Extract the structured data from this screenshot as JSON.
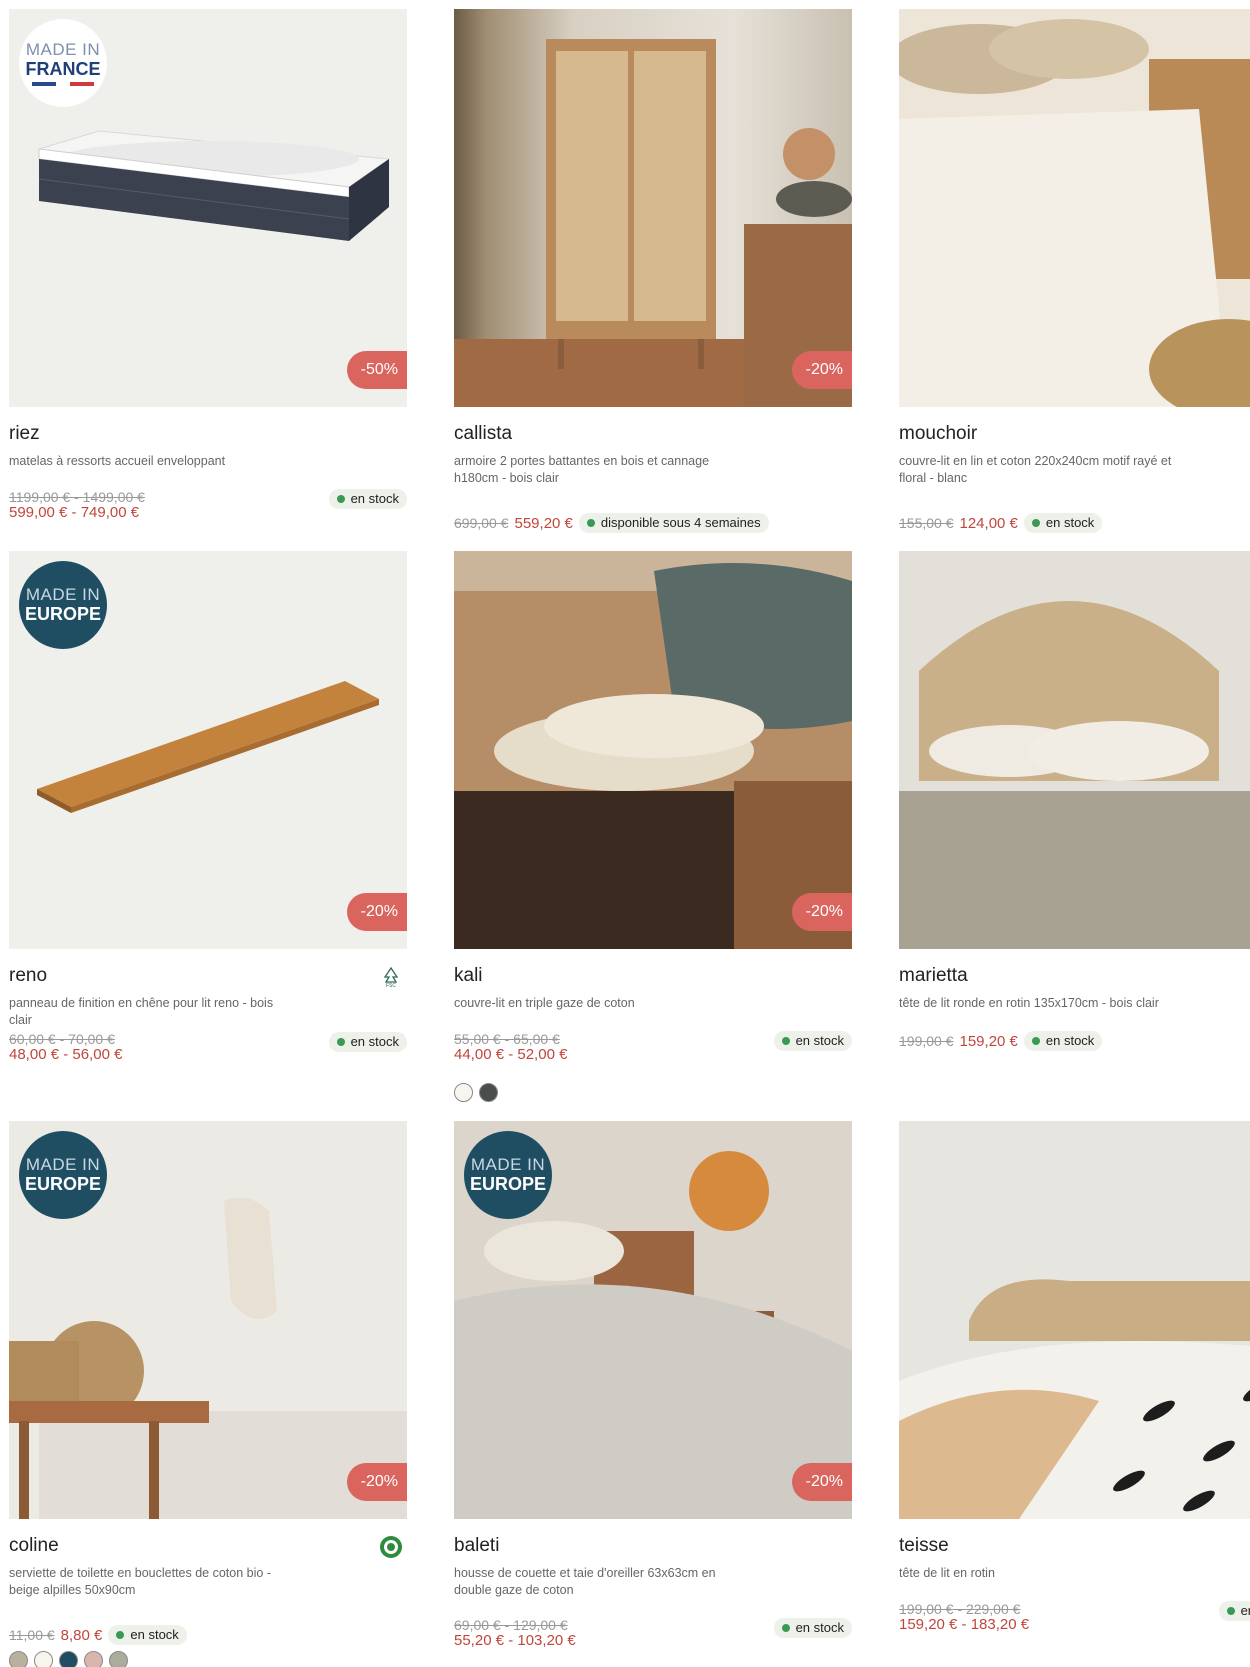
{
  "products": [
    {
      "name": "riez",
      "desc": "matelas à ressorts accueil enveloppant",
      "old": "1199,00 € - 1499,00 €",
      "new": "599,00 € - 749,00 €",
      "discount": "-50%",
      "stock": "en stock",
      "origin_l1": "MADE IN",
      "origin_l2": "FRANCE"
    },
    {
      "name": "callista",
      "desc": "armoire 2 portes battantes en bois et cannage h180cm - bois clair",
      "old": "699,00 €",
      "new": "559,20 €",
      "discount": "-20%",
      "stock": "disponible sous 4 semaines"
    },
    {
      "name": "mouchoir",
      "desc": "couvre-lit en lin et coton 220x240cm motif rayé et floral - blanc",
      "old": "155,00 €",
      "new": "124,00 €",
      "stock": "en stock"
    },
    {
      "name": "reno",
      "desc": "panneau de finition en chêne pour lit reno - bois clair",
      "old": "60,00 € - 70,00 €",
      "new": "48,00 € - 56,00 €",
      "discount": "-20%",
      "stock": "en stock",
      "origin_l1": "MADE IN",
      "origin_l2": "EUROPE",
      "eco": "fsc-icon"
    },
    {
      "name": "kali",
      "desc": "couvre-lit en triple gaze de coton",
      "old": "55,00 € - 65,00 €",
      "new": "44,00 € - 52,00 €",
      "discount": "-20%",
      "stock": "en stock",
      "swatches": [
        "#f7f5ee",
        "#4a4d4b"
      ]
    },
    {
      "name": "marietta",
      "desc": "tête de lit ronde en rotin 135x170cm - bois clair",
      "old": "199,00 €",
      "new": "159,20 €",
      "stock": "en stock"
    },
    {
      "name": "coline",
      "desc": "serviette de toilette en bouclettes de coton bio - beige alpilles 50x90cm",
      "old": "11,00 €",
      "new": "8,80 €",
      "discount": "-20%",
      "stock": "en stock",
      "origin_l1": "MADE IN",
      "origin_l2": "EUROPE",
      "eco": "organic-cotton-icon",
      "swatches": [
        "#b8b19d",
        "#f7f5ee",
        "#1f4e63",
        "#d9b5ad",
        "#a9ad9a"
      ]
    },
    {
      "name": "baleti",
      "desc": "housse de couette et taie d'oreiller 63x63cm en double gaze de coton",
      "old": "69,00 € - 129,00 €",
      "new": "55,20 € - 103,20 €",
      "discount": "-20%",
      "stock": "en stock",
      "origin_l1": "MADE IN",
      "origin_l2": "EUROPE"
    },
    {
      "name": "teisse",
      "desc": "tête de lit en rotin",
      "old": "199,00 € - 229,00 €",
      "new": "159,20 € - 183,20 €",
      "stock": "en stock"
    }
  ]
}
